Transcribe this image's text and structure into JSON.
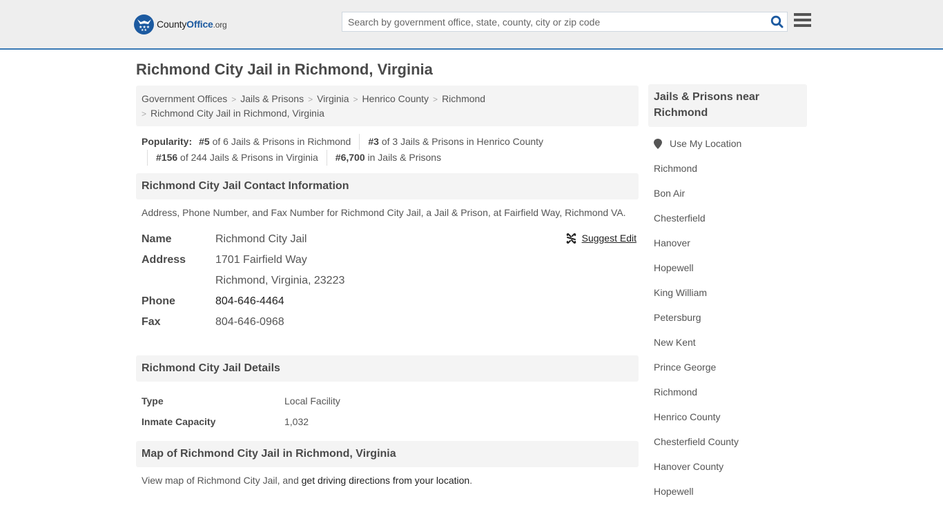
{
  "header": {
    "logo": {
      "part1": "County",
      "part2": "Office",
      "part3": ".org"
    },
    "search": {
      "placeholder": "Search by government office, state, county, city or zip code",
      "value": ""
    },
    "icons": {
      "search": "search-icon",
      "menu": "hamburger-menu-icon"
    },
    "accent_color": "#3a7ab5"
  },
  "page": {
    "title": "Richmond City Jail in Richmond, Virginia"
  },
  "breadcrumb": {
    "items": [
      "Government Offices",
      "Jails & Prisons",
      "Virginia",
      "Henrico County",
      "Richmond"
    ],
    "current": "Richmond City Jail in Richmond, Virginia"
  },
  "popularity": {
    "label": "Popularity:",
    "items": [
      {
        "rank": "#5",
        "text": "of 6 Jails & Prisons in Richmond"
      },
      {
        "rank": "#3",
        "text": "of 3 Jails & Prisons in Henrico County"
      },
      {
        "rank": "#156",
        "text": "of 244 Jails & Prisons in Virginia"
      },
      {
        "rank": "#6,700",
        "text": "in Jails & Prisons"
      }
    ]
  },
  "contact": {
    "heading": "Richmond City Jail Contact Information",
    "description": "Address, Phone Number, and Fax Number for Richmond City Jail, a Jail & Prison, at Fairfield Way, Richmond VA.",
    "suggest_edit": "Suggest Edit",
    "name_label": "Name",
    "name": "Richmond City Jail",
    "address_label": "Address",
    "address_line1": "1701 Fairfield Way",
    "address_line2": "Richmond, Virginia, 23223",
    "phone_label": "Phone",
    "phone": "804-646-4464",
    "fax_label": "Fax",
    "fax": "804-646-0968"
  },
  "details": {
    "heading": "Richmond City Jail Details",
    "rows": [
      {
        "label": "Type",
        "value": "Local Facility"
      },
      {
        "label": "Inmate Capacity",
        "value": "1,032"
      }
    ]
  },
  "map": {
    "heading": "Map of Richmond City Jail in Richmond, Virginia",
    "text_before": "View map of Richmond City Jail, and ",
    "link": "get driving directions from your location",
    "text_after": "."
  },
  "sidebar": {
    "heading": "Jails & Prisons near Richmond",
    "use_location": "Use My Location",
    "items": [
      "Richmond",
      "Bon Air",
      "Chesterfield",
      "Hanover",
      "Hopewell",
      "King William",
      "Petersburg",
      "New Kent",
      "Prince George",
      "Richmond",
      "Henrico County",
      "Chesterfield County",
      "Hanover County",
      "Hopewell"
    ]
  }
}
